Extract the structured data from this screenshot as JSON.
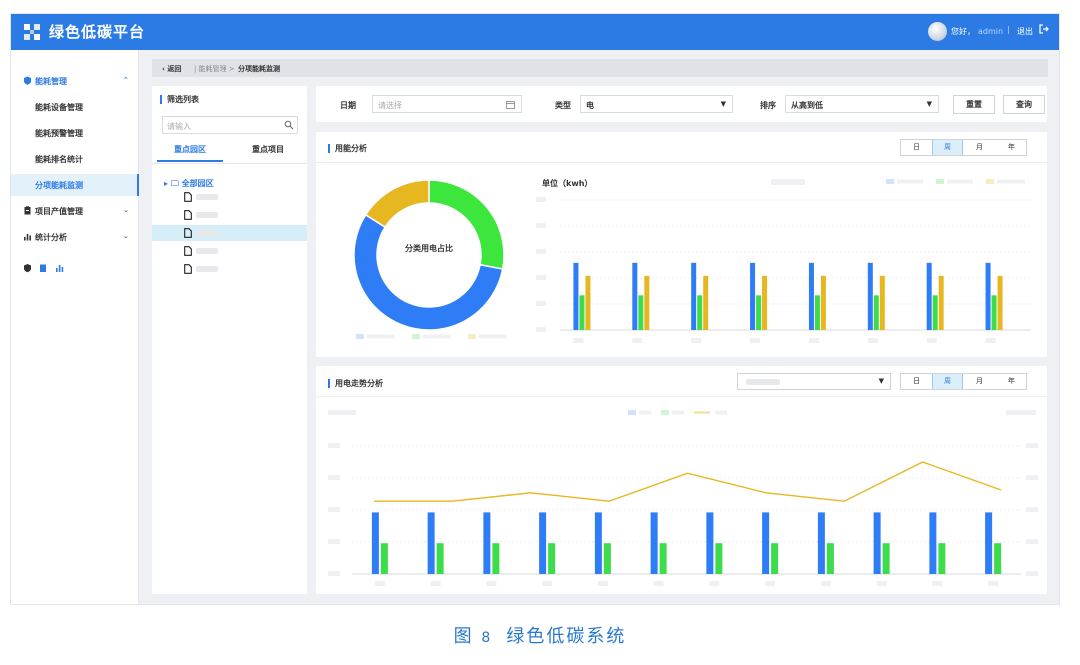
{
  "app": {
    "title": "绿色低碳平台",
    "greeting": "您好，",
    "user": "admin",
    "separator": "|",
    "logout": "退出"
  },
  "sidebar": {
    "groups": [
      {
        "label": "能耗管理",
        "icon": "shield-icon",
        "expanded": true
      },
      {
        "label": "项目产值管理",
        "icon": "clipboard-icon",
        "expanded": false
      },
      {
        "label": "统计分析",
        "icon": "bar-chart-icon",
        "expanded": false
      }
    ],
    "items": [
      {
        "label": "能耗设备管理"
      },
      {
        "label": "能耗预警管理"
      },
      {
        "label": "能耗排名统计"
      },
      {
        "label": "分项能耗监测",
        "selected": true
      }
    ]
  },
  "breadcrumb": {
    "back": "‹ 返回",
    "middle": "| 能耗管理 >",
    "current": "分项能耗监测"
  },
  "filter": {
    "title": "筛选列表",
    "search_placeholder": "请输入",
    "tabs": [
      "重点园区",
      "重点项目"
    ],
    "active_tab": 0,
    "tree_root": "全部园区",
    "tree_items": 5,
    "selected_item": 2
  },
  "form": {
    "date_label": "日期",
    "date_placeholder": "请选择",
    "type_label": "类型",
    "type_value": "电",
    "sort_label": "排序",
    "sort_value": "从高到低",
    "reset": "重置",
    "query": "查询"
  },
  "period_options": [
    "日",
    "周",
    "月",
    "年"
  ],
  "active_period": 1,
  "energy_panel": {
    "title": "用能分析",
    "donut_center": "分类用电占比",
    "unit": "单位（kwh）"
  },
  "trend_panel": {
    "title": "用电走势分析"
  },
  "colors": {
    "blue": "#2e7cf6",
    "green": "#3ddc4a",
    "yellow": "#e7b722",
    "brand": "#2c7be5"
  },
  "chart_data": [
    {
      "type": "pie",
      "values": [
        0.28,
        0.56,
        0.16
      ],
      "colors": [
        "#3de63d",
        "#2e7cf6",
        "#e7b722"
      ]
    },
    {
      "type": "bar",
      "series": [
        {
          "values": [
            3.1,
            3.1,
            3.1,
            3.1,
            3.1,
            3.1,
            3.1,
            3.1
          ],
          "color": "#2e7cf6"
        },
        {
          "values": [
            1.6,
            1.6,
            1.6,
            1.6,
            1.6,
            1.6,
            1.6,
            1.6
          ],
          "color": "#3ddc4a"
        },
        {
          "values": [
            2.5,
            2.5,
            2.5,
            2.5,
            2.5,
            2.5,
            2.5,
            2.5
          ],
          "color": "#e7b722"
        }
      ],
      "ylim": [
        0,
        6
      ]
    },
    {
      "type": "bar+line",
      "series": [
        {
          "kind": "bar",
          "values": [
            2.2,
            2.2,
            2.2,
            2.2,
            2.2,
            2.2,
            2.2,
            2.2,
            2.2,
            2.2,
            2.2,
            2.2
          ],
          "color": "#2e7cf6"
        },
        {
          "kind": "bar",
          "values": [
            1.1,
            1.1,
            1.1,
            1.1,
            1.1,
            1.1,
            1.1,
            1.1,
            1.1,
            1.1,
            1.1,
            1.1
          ],
          "color": "#3ddc4a"
        },
        {
          "kind": "line",
          "values": [
            2.6,
            2.6,
            2.9,
            2.6,
            3.6,
            2.9,
            2.6,
            4.0,
            3.0
          ],
          "color": "#e7b722"
        }
      ],
      "ylim": [
        0,
        5
      ]
    }
  ]
}
